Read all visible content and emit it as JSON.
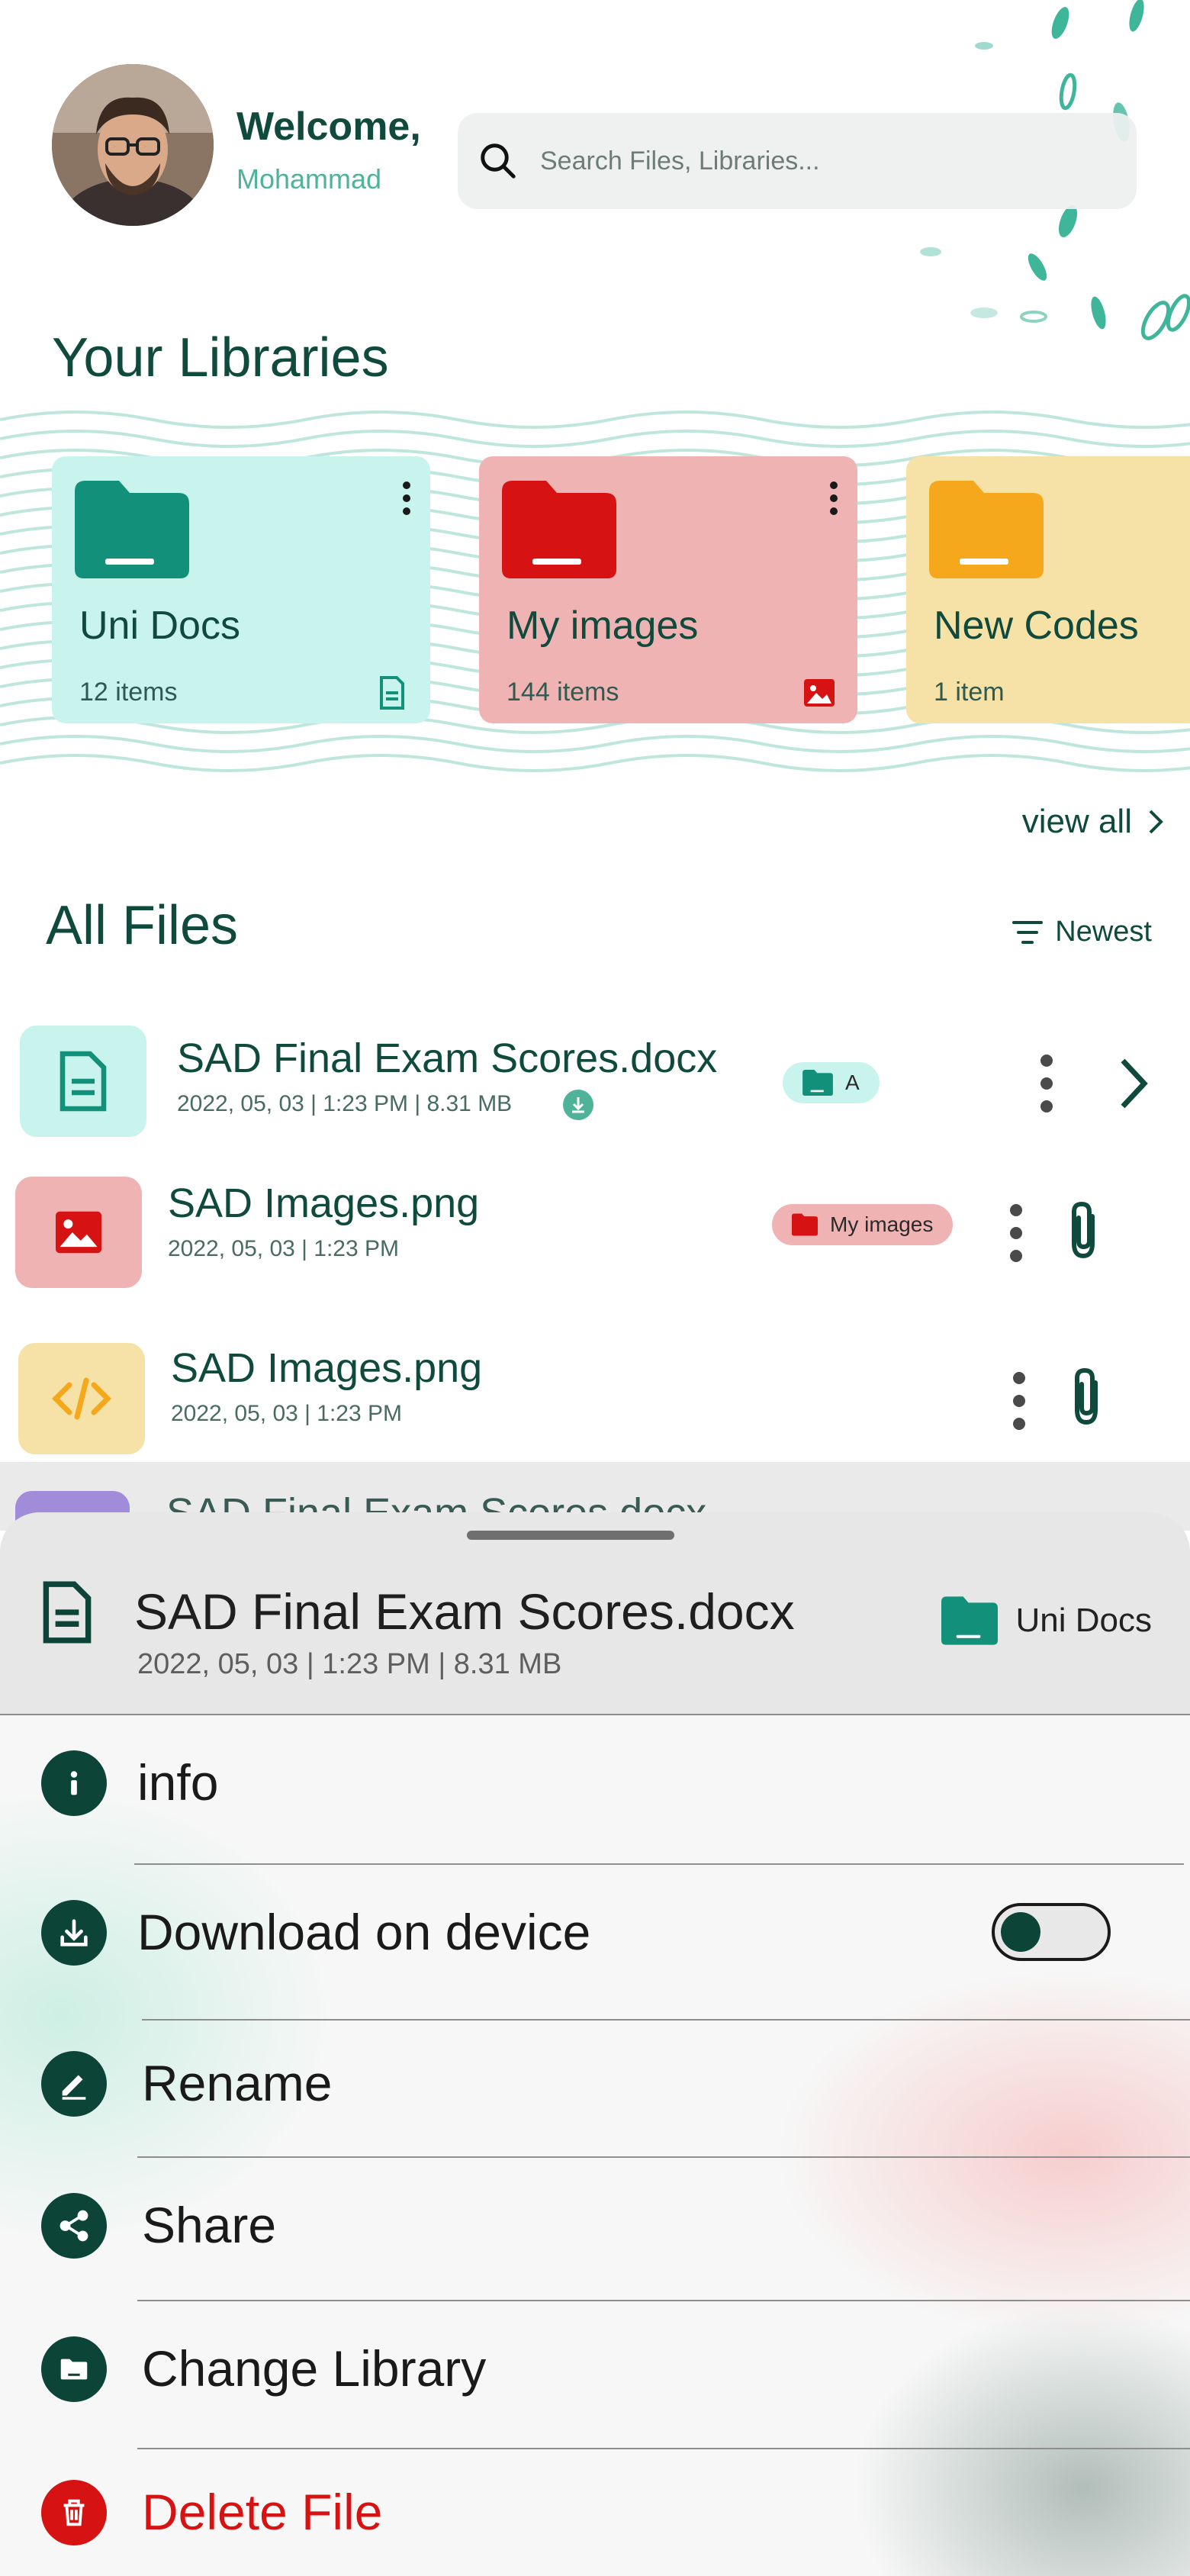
{
  "header": {
    "greeting": "Welcome,",
    "username": "Mohammad",
    "search_placeholder": "Search Files, Libraries..."
  },
  "libraries": {
    "title": "Your Libraries",
    "view_all": "view all",
    "items": [
      {
        "name": "Uni Docs",
        "count": "12 items",
        "icon": "document-icon",
        "bg": "#c9f4ee",
        "folder_color": "#13907a"
      },
      {
        "name": "My images",
        "count": "144 items",
        "icon": "image-icon",
        "bg": "#f0b3b3",
        "folder_color": "#d71212"
      },
      {
        "name": "New Codes",
        "count": "1 item",
        "icon": "code-icon",
        "bg": "#f6e2a6",
        "folder_color": "#f5a81c"
      }
    ]
  },
  "files": {
    "title": "All Files",
    "sort_label": "Newest",
    "items": [
      {
        "name": "SAD Final Exam Scores.docx",
        "meta": "2022, 05, 03 | 1:23 PM | 8.31 MB",
        "chip": "A",
        "downloaded": true,
        "action": "chevron-right-icon"
      },
      {
        "name": "SAD Images.png",
        "meta": "2022, 05, 03 | 1:23 PM",
        "chip": "My images",
        "action": "paperclip-icon"
      },
      {
        "name": "SAD Images.png",
        "meta": "2022, 05, 03 | 1:23 PM",
        "action": "paperclip-icon"
      },
      {
        "name": "SAD Final Exam Scores.docx"
      }
    ]
  },
  "sheet": {
    "file_name": "SAD Final Exam Scores.docx",
    "file_meta": "2022, 05, 03 | 1:23 PM | 8.31 MB",
    "library": "Uni Docs",
    "menu": {
      "info": "info",
      "download": "Download on device",
      "download_enabled": false,
      "rename": "Rename",
      "share": "Share",
      "change_library": "Change Library",
      "delete": "Delete File"
    }
  },
  "colors": {
    "primary": "#0f4a3d",
    "accent": "#4fb39a",
    "danger": "#d71212"
  }
}
